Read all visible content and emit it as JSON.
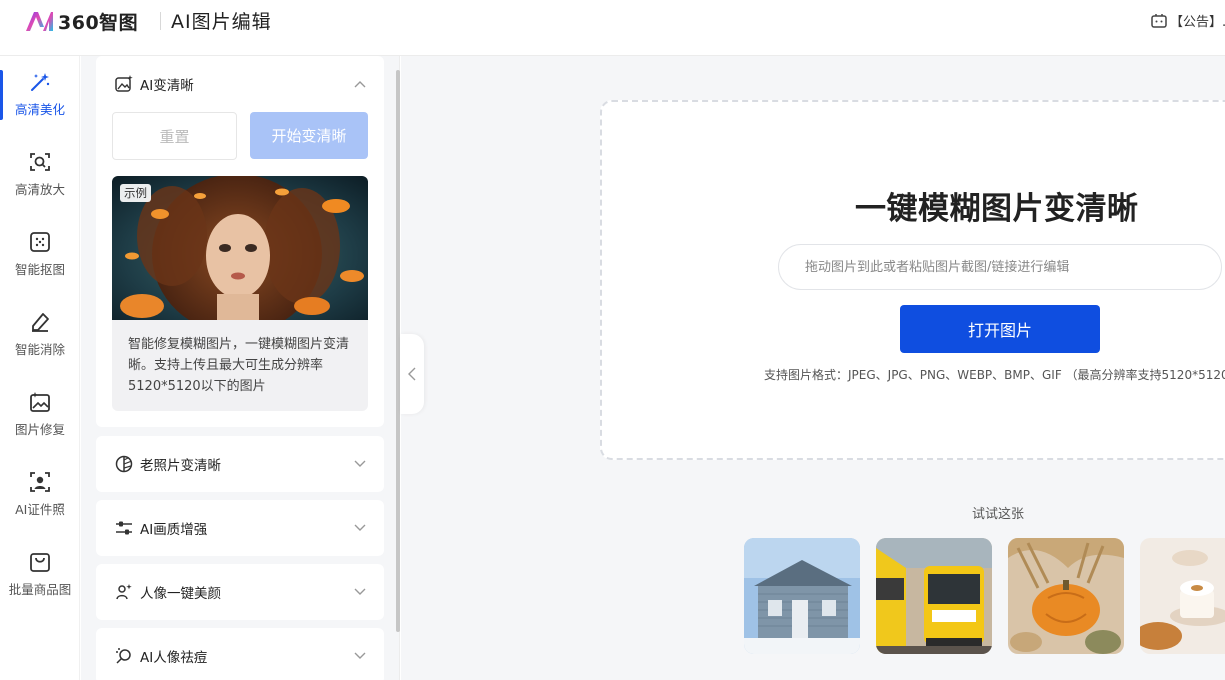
{
  "header": {
    "brand": "360智图",
    "app_title": "AI图片编辑",
    "notice": "【公告】..."
  },
  "rail": {
    "items": [
      {
        "label": "高清美化",
        "icon": "magic-wand-icon",
        "active": true
      },
      {
        "label": "高清放大",
        "icon": "zoom-frame-icon"
      },
      {
        "label": "智能抠图",
        "icon": "cutout-icon"
      },
      {
        "label": "智能消除",
        "icon": "eraser-icon"
      },
      {
        "label": "图片修复",
        "icon": "image-repair-icon"
      },
      {
        "label": "AI证件照",
        "icon": "id-photo-icon"
      },
      {
        "label": "批量商品图",
        "icon": "shopping-bag-icon"
      }
    ]
  },
  "panel": {
    "ai_sharpen": {
      "title": "AI变清晰",
      "reset": "重置",
      "start": "开始变清晰",
      "sample_tag": "示例",
      "desc": "智能修复模糊图片，一键模糊图片变清晰。支持上传且最大可生成分辨率5120*5120以下的图片"
    },
    "old_photo": {
      "title": "老照片变清晰"
    },
    "quality": {
      "title": "AI画质增强"
    },
    "beauty": {
      "title": "人像一键美颜"
    },
    "acne": {
      "title": "AI人像祛痘"
    }
  },
  "main": {
    "title": "一键模糊图片变清晰",
    "input_placeholder": "拖动图片到此或者粘贴图片截图/链接进行编辑",
    "open_button": "打开图片",
    "formats": "支持图片格式：JPEG、JPG、PNG、WEBP、BMP、GIF （最高分辨率支持5120*5120",
    "try_label": "试试这张"
  },
  "colors": {
    "accent": "#0f4ee0",
    "accent_light": "#a9c3f7",
    "active": "#1a56e8"
  }
}
